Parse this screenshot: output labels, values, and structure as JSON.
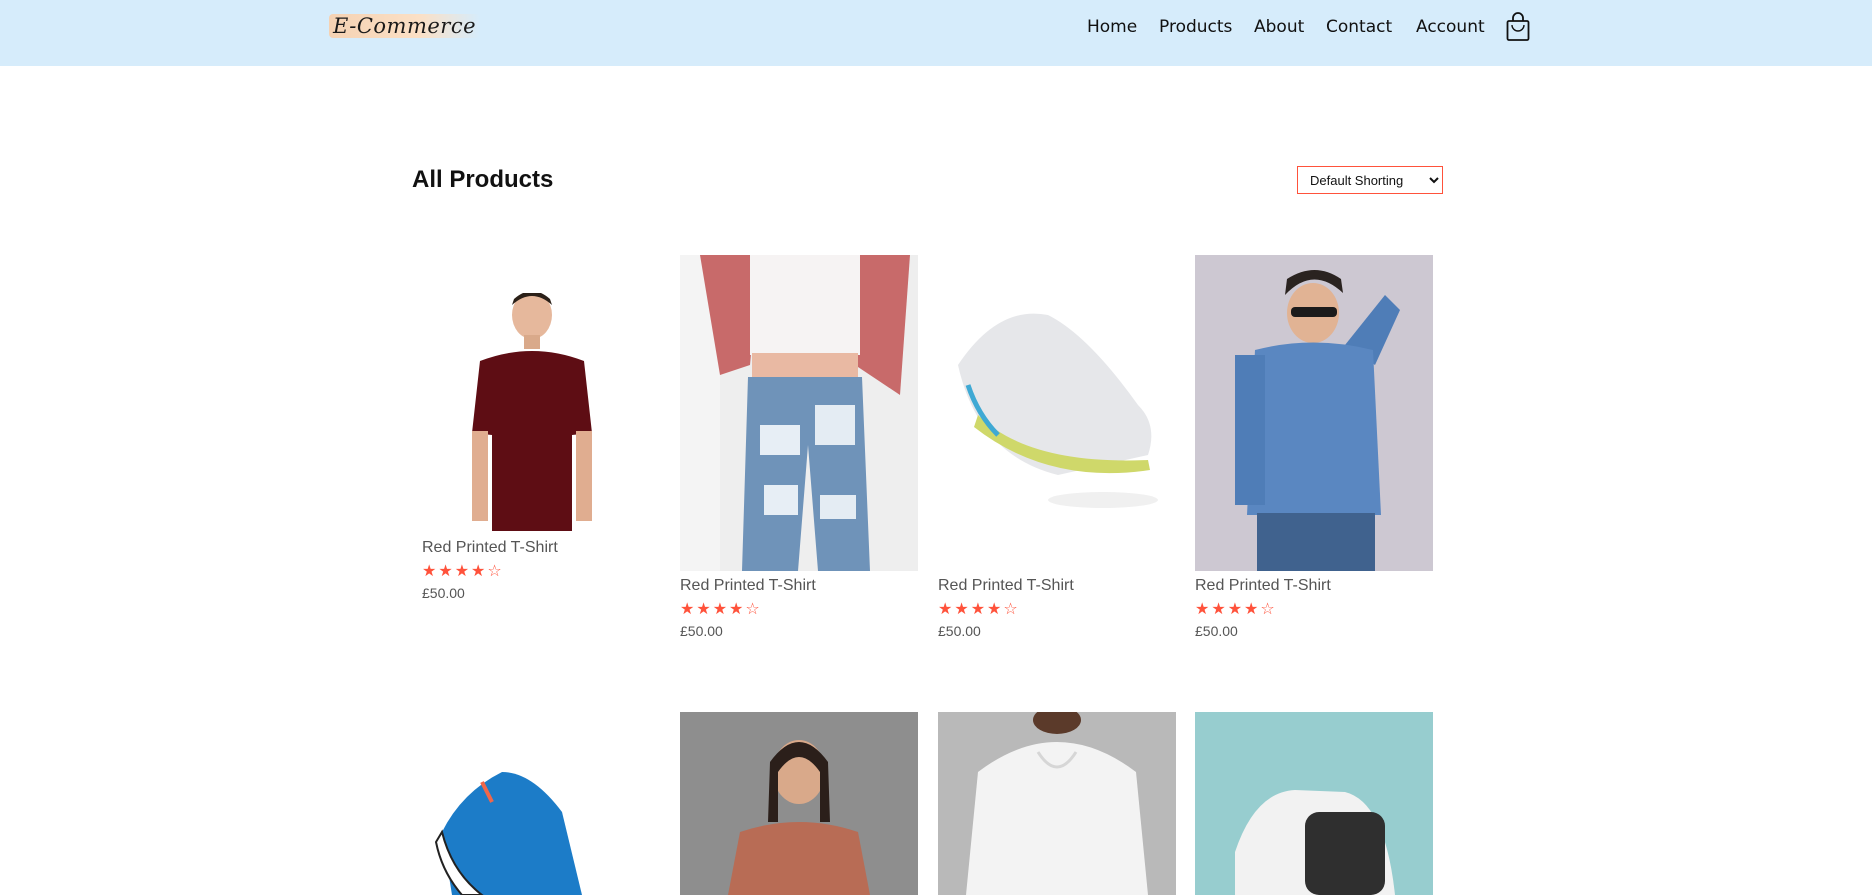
{
  "header": {
    "logo_text": "E-Commerce",
    "nav": [
      "Home",
      "Products",
      "About",
      "Contact",
      "Account"
    ],
    "cart_icon": "shopping-bag-icon"
  },
  "main": {
    "title": "All Products",
    "sort": {
      "selected": "Default Shorting"
    }
  },
  "products": [
    {
      "name": "Red Printed T-Shirt",
      "rating": 4,
      "rating_max": 5,
      "stars": "★★★★☆",
      "price": "£50.00"
    },
    {
      "name": "Red Printed T-Shirt",
      "rating": 4,
      "rating_max": 5,
      "stars": "★★★★☆",
      "price": "£50.00"
    },
    {
      "name": "Red Printed T-Shirt",
      "rating": 4,
      "rating_max": 5,
      "stars": "★★★★☆",
      "price": "£50.00"
    },
    {
      "name": "Red Printed T-Shirt",
      "rating": 4,
      "rating_max": 5,
      "stars": "★★★★☆",
      "price": "£50.00"
    }
  ],
  "colors": {
    "header_bg": "#d6ecfb",
    "accent": "#ff523b",
    "text": "#555555"
  }
}
